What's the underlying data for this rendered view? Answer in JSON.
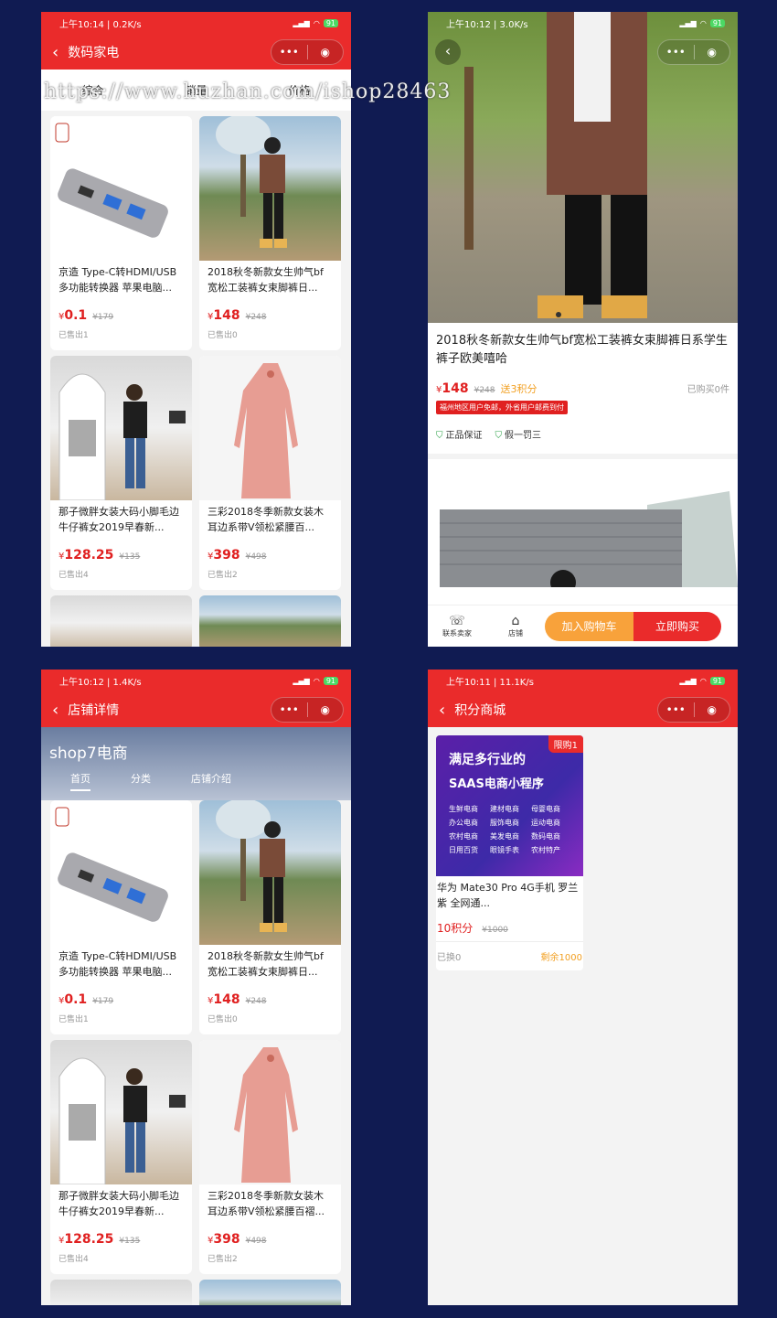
{
  "watermark": "https://www.huzhan.com/ishop28463",
  "p1": {
    "status": {
      "time": "上午10:14 | 0.2K/s",
      "battery": "91"
    },
    "title": "数码家电",
    "tabs": [
      "综合",
      "销量",
      "价格"
    ],
    "products": [
      {
        "title": "京造 Type-C转HDMI/USB多功能转换器 苹果电脑...",
        "cur": "¥",
        "price": "0.1",
        "old": "¥179",
        "sold": "已售出1"
      },
      {
        "title": "2018秋冬新款女生帅气bf宽松工装裤女束脚裤日...",
        "cur": "¥",
        "price": "148",
        "old": "¥248",
        "sold": "已售出0"
      },
      {
        "title": "那子微胖女装大码小脚毛边牛仔裤女2019早春新...",
        "cur": "¥",
        "price": "128.25",
        "old": "¥135",
        "sold": "已售出4"
      },
      {
        "title": "三彩2018冬季新款女装木耳边系带V领松紧腰百...",
        "cur": "¥",
        "price": "398",
        "old": "¥498",
        "sold": "已售出2"
      }
    ]
  },
  "p2": {
    "status": {
      "time": "上午10:12 | 3.0K/s",
      "battery": "91"
    },
    "title": "2018秋冬新款女生帅气bf宽松工装裤女束脚裤日系学生裤子欧美嘻哈",
    "cur": "¥",
    "price": "148",
    "old": "¥248",
    "points": "送3积分",
    "bought": "已购买0件",
    "tag": "福州地区用户免邮，外省用户邮费到付",
    "guarantee": [
      "正品保证",
      "假一罚三"
    ],
    "bottom": {
      "contact": "联系卖家",
      "store": "店铺",
      "cart": "加入购物车",
      "buy": "立即购买"
    }
  },
  "p3": {
    "status": {
      "time": "上午10:12 | 1.4K/s",
      "battery": "91"
    },
    "title": "店铺详情",
    "store_name": "shop7电商",
    "tabs": [
      "首页",
      "分类",
      "店铺介绍"
    ],
    "products": [
      {
        "title": "京造 Type-C转HDMI/USB多功能转换器 苹果电脑...",
        "cur": "¥",
        "price": "0.1",
        "old": "¥179",
        "sold": "已售出1"
      },
      {
        "title": "2018秋冬新款女生帅气bf宽松工装裤女束脚裤日...",
        "cur": "¥",
        "price": "148",
        "old": "¥248",
        "sold": "已售出0"
      },
      {
        "title": "那子微胖女装大码小脚毛边牛仔裤女2019早春新...",
        "cur": "¥",
        "price": "128.25",
        "old": "¥135",
        "sold": "已售出4"
      },
      {
        "title": "三彩2018冬季新款女装木耳边系带V领松紧腰百褶...",
        "cur": "¥",
        "price": "398",
        "old": "¥498",
        "sold": "已售出2"
      }
    ]
  },
  "p4": {
    "status": {
      "time": "上午10:11 | 11.1K/s",
      "battery": "91"
    },
    "title": "积分商城",
    "card": {
      "limit": "限购1",
      "h1": "满足多行业的",
      "h2": "SAAS电商小程序",
      "keywords": [
        "生鲜电商",
        "建材电商",
        "母婴电商",
        "办公电商",
        "服饰电商",
        "运动电商",
        "农村电商",
        "美发电商",
        "数码电商",
        "日用百货",
        "眼镜手表",
        "农村特产"
      ],
      "title": "华为 Mate30 Pro 4G手机 罗兰紫 全网通...",
      "price": "10积分",
      "old": "¥1000",
      "exchanged": "已换0",
      "left": "剩余1000"
    }
  }
}
